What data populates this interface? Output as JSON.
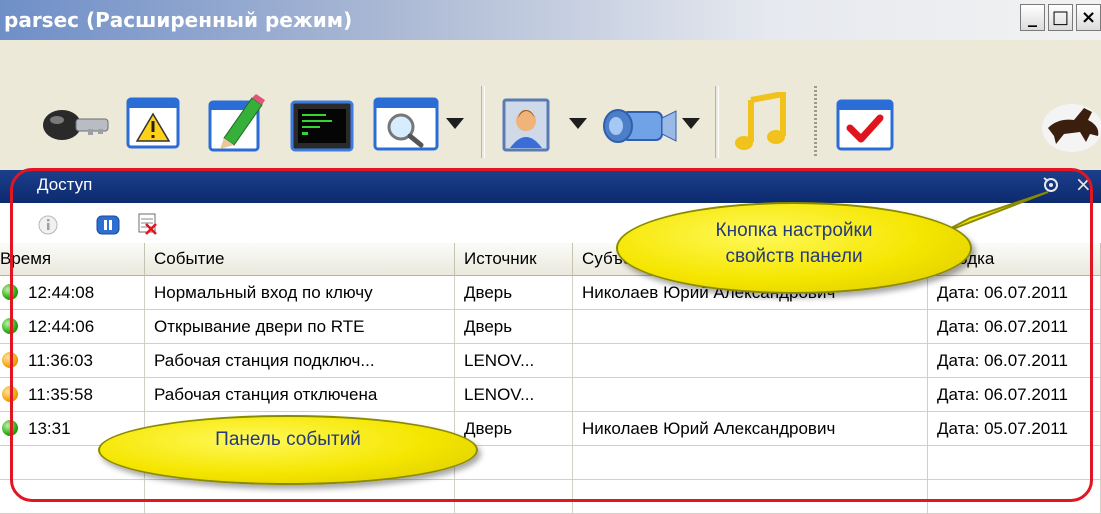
{
  "window": {
    "title": "parsec (Расширенный режим)",
    "controls": [
      "_",
      "□",
      "×"
    ]
  },
  "toolbar": {
    "icons": [
      "key-icon",
      "warning-icon",
      "pencil-icon",
      "terminal-icon",
      "search-icon",
      "person-icon",
      "camera-icon",
      "music-icon",
      "checkmark-icon",
      "horse-logo-icon"
    ]
  },
  "panel": {
    "title": "Доступ",
    "close": "×",
    "toolbar_icons": [
      "info-icon",
      "pause-icon",
      "clear-icon"
    ]
  },
  "table": {
    "headers": [
      "Время",
      "Событие",
      "Источник",
      "Субъект",
      "Сводка"
    ],
    "rows": [
      {
        "status": "green",
        "time": "12:44:08",
        "event": "Нормальный вход по ключу",
        "source": "Дверь",
        "subject": "Николаев Юрий Александрович",
        "summary": "Дата: 06.07.2011"
      },
      {
        "status": "green",
        "time": "12:44:06",
        "event": "Открывание двери по RTE",
        "source": "Дверь",
        "subject": "",
        "summary": "Дата: 06.07.2011"
      },
      {
        "status": "orange",
        "time": "11:36:03",
        "event": "Рабочая станция подключ...",
        "source": "LENOV...",
        "subject": "",
        "summary": "Дата: 06.07.2011"
      },
      {
        "status": "orange",
        "time": "11:35:58",
        "event": "Рабочая станция отключена",
        "source": "LENOV...",
        "subject": "",
        "summary": "Дата: 06.07.2011"
      },
      {
        "status": "green",
        "time": "13:31",
        "event": "",
        "source": "Дверь",
        "subject": "Николаев Юрий Александрович",
        "summary": "Дата: 05.07.2011"
      }
    ]
  },
  "callouts": {
    "settings_line1": "Кнопка настройки",
    "settings_line2": "свойств панели",
    "events_panel": "Панель событий"
  },
  "colors": {
    "panel_header": "#0c2a6e",
    "highlight_frame": "#e01622",
    "callout_fill": "#f5e600",
    "callout_text": "#243a7a"
  }
}
